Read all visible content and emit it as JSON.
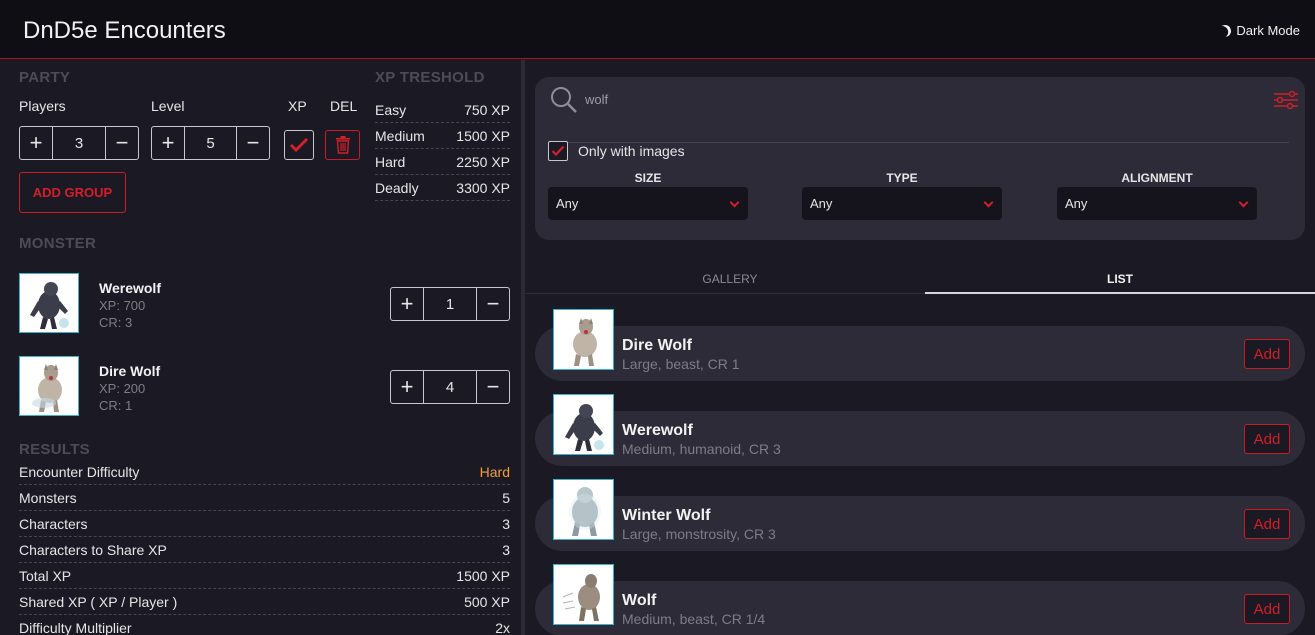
{
  "header": {
    "title": "DnD5e Encounters",
    "dark_mode_label": "Dark Mode"
  },
  "party": {
    "title": "PARTY",
    "players_label": "Players",
    "level_label": "Level",
    "xp_label": "XP",
    "del_label": "DEL",
    "players_value": "3",
    "level_value": "5",
    "add_group_label": "ADD GROUP"
  },
  "xp_threshold": {
    "title": "XP TRESHOLD",
    "rows": [
      {
        "label": "Easy",
        "value": "750 XP"
      },
      {
        "label": "Medium",
        "value": "1500 XP"
      },
      {
        "label": "Hard",
        "value": "2250 XP"
      },
      {
        "label": "Deadly",
        "value": "3300 XP"
      }
    ]
  },
  "monster": {
    "title": "MONSTER",
    "items": [
      {
        "name": "Werewolf",
        "xp": "XP: 700",
        "cr": "CR: 3",
        "count": "1"
      },
      {
        "name": "Dire Wolf",
        "xp": "XP: 200",
        "cr": "CR: 1",
        "count": "4"
      }
    ]
  },
  "results": {
    "title": "RESULTS",
    "difficulty_color": "#f39c3c",
    "rows": [
      {
        "label": "Encounter Difficulty",
        "value": "Hard"
      },
      {
        "label": "Monsters",
        "value": "5"
      },
      {
        "label": "Characters",
        "value": "3"
      },
      {
        "label": "Characters to Share XP",
        "value": "3"
      },
      {
        "label": "Total XP",
        "value": "1500 XP"
      },
      {
        "label": "Shared XP ( XP / Player )",
        "value": "500 XP"
      },
      {
        "label": "Difficulty Multiplier",
        "value": "2x"
      }
    ]
  },
  "search": {
    "value": "wolf",
    "only_images_label": "Only with images",
    "only_images_checked": true,
    "filters": [
      {
        "label": "SIZE",
        "value": "Any"
      },
      {
        "label": "TYPE",
        "value": "Any"
      },
      {
        "label": "ALIGNMENT",
        "value": "Any"
      }
    ]
  },
  "tabs": {
    "gallery": "GALLERY",
    "list": "LIST",
    "active": "list"
  },
  "list": {
    "add_label": "Add",
    "items": [
      {
        "name": "Dire Wolf",
        "desc": "Large, beast, CR 1"
      },
      {
        "name": "Werewolf",
        "desc": "Medium, humanoid, CR 3"
      },
      {
        "name": "Winter Wolf",
        "desc": "Large, monstrosity, CR 3"
      },
      {
        "name": "Wolf",
        "desc": "Medium, beast, CR 1/4"
      }
    ]
  },
  "colors": {
    "accent": "#d31f28",
    "background": "#1b1a24",
    "card": "#2c2b37",
    "thumb_border": "#3ab4c8"
  }
}
